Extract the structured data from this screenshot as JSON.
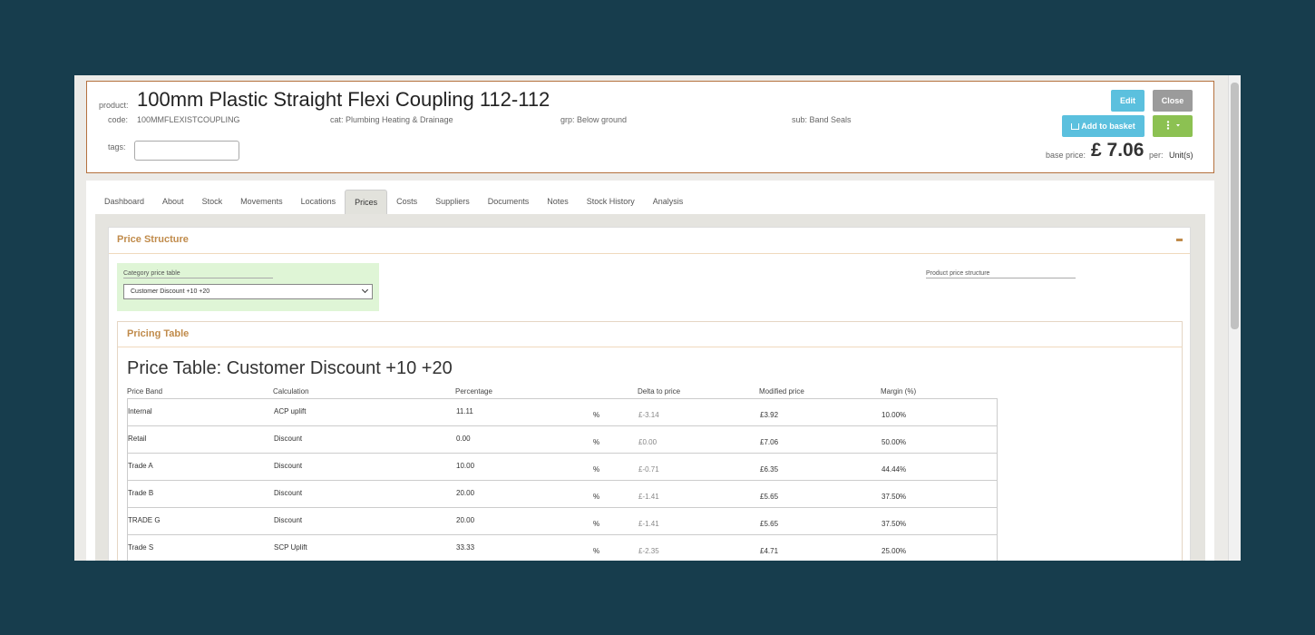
{
  "header": {
    "product_label": "product:",
    "product_title": "100mm Plastic Straight Flexi Coupling 112-112",
    "code_label": "code:",
    "code_value": "100MMFLEXISTCOUPLING",
    "cat": "cat: Plumbing Heating & Drainage",
    "grp": "grp: Below ground",
    "sub": "sub: Band Seals",
    "tags_label": "tags:",
    "tags_value": "",
    "edit_label": "Edit",
    "close_label": "Close",
    "basket_label": "Add to basket",
    "more_icon": "vertical-ellipsis-caret",
    "base_price_label": "base price:",
    "base_price": "£ 7.06",
    "per_label": "per:",
    "per_value": "Unit(s)"
  },
  "tabs": [
    "Dashboard",
    "About",
    "Stock",
    "Movements",
    "Locations",
    "Prices",
    "Costs",
    "Suppliers",
    "Documents",
    "Notes",
    "Stock History",
    "Analysis"
  ],
  "active_tab": "Prices",
  "price_structure": {
    "title": "Price Structure",
    "category_label": "Category price table",
    "category_selected": "Customer Discount +10 +20",
    "product_structure_label": "Product price structure"
  },
  "pricing_table": {
    "section_title": "Pricing Table",
    "heading": "Price Table: Customer Discount +10 +20",
    "columns": [
      "Price Band",
      "Calculation",
      "Percentage",
      "Delta to price",
      "Modified price",
      "Margin (%)"
    ],
    "percent_symbol": "%",
    "rows": [
      {
        "band": "Internal",
        "calc": "ACP uplift",
        "pct": "11.11",
        "delta": "£-3.14",
        "modified": "£3.92",
        "margin": "10.00%"
      },
      {
        "band": "Retail",
        "calc": "Discount",
        "pct": "0.00",
        "delta": "£0.00",
        "modified": "£7.06",
        "margin": "50.00%"
      },
      {
        "band": "Trade A",
        "calc": "Discount",
        "pct": "10.00",
        "delta": "£-0.71",
        "modified": "£6.35",
        "margin": "44.44%"
      },
      {
        "band": "Trade B",
        "calc": "Discount",
        "pct": "20.00",
        "delta": "£-1.41",
        "modified": "£5.65",
        "margin": "37.50%"
      },
      {
        "band": "TRADE G",
        "calc": "Discount",
        "pct": "20.00",
        "delta": "£-1.41",
        "modified": "£5.65",
        "margin": "37.50%"
      },
      {
        "band": "Trade S",
        "calc": "SCP Uplift",
        "pct": "33.33",
        "delta": "£-2.35",
        "modified": "£4.71",
        "margin": "25.00%"
      }
    ]
  },
  "colors": {
    "background": "#173d4d",
    "accent": "#c08b4b",
    "info": "#5bc0de",
    "success": "#8cc152"
  }
}
